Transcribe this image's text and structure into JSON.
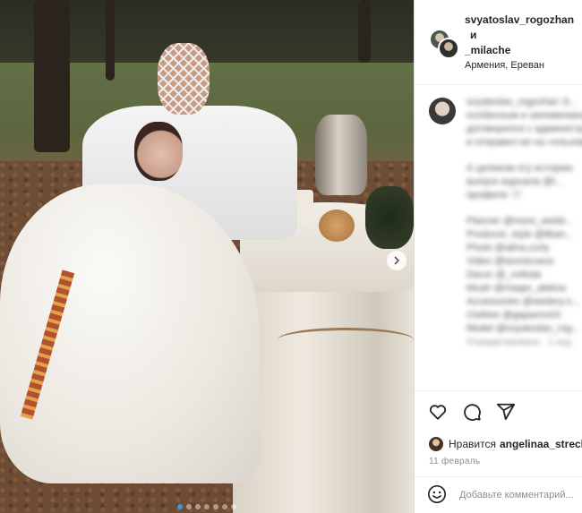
{
  "header": {
    "user1": "svyatoslav_rogozhan",
    "conjunction": "и",
    "user2": "_milache",
    "location": "Армения, Ереван"
  },
  "caption": {
    "lines": [
      "svyatoslav_rogozhan Э...",
      "особенным и запоминающимся",
      "договорился с администрацией",
      "и отправил ее на «ольховую»",
      "",
      "А целиком эту историю",
      "выпуск журнала @l...",
      "профиля 🤍",
      "",
      "Planner @more_wedd...",
      "Producer, style @liban...",
      "Photo @alina.curly",
      "Video @tanmicuess",
      "Decor @_nofoda",
      "Muah @maqer_aleksa",
      "Accessories @wedery.n...",
      "Clothes @gaparovich",
      "Model @svyatoslav_rog..."
    ],
    "footer": "Отредактировано · 1 нед."
  },
  "actions": {
    "like_icon": "heart-icon",
    "comment_icon": "comment-bubble-icon",
    "share_icon": "paper-plane-icon"
  },
  "likes": {
    "prefix": "Нравится",
    "user": "angelinaa_strech"
  },
  "date": "11 февраль",
  "comment": {
    "placeholder": "Добавьте комментарий...",
    "emoji_icon": "smiley-icon"
  },
  "carousel": {
    "total": 7,
    "current": 1,
    "next_icon": "chevron-right-icon"
  },
  "colors": {
    "accent": "#3897f0",
    "text": "#262626",
    "muted": "#8e8e8e",
    "border": "#dbdbdb"
  }
}
